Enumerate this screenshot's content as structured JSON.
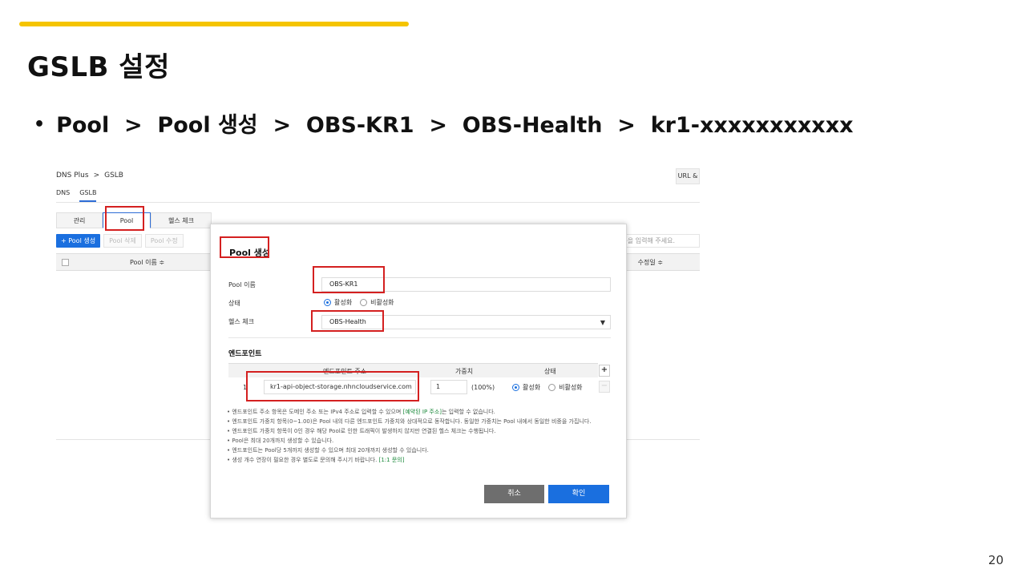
{
  "slide": {
    "title": "GSLB 설정",
    "breadcrumb": "Pool  >  Pool 생성  >  OBS-KR1  >  OBS-Health  >  kr1-xxxxxxxxxxx",
    "page_number": "20",
    "accent_color": "#f5c400"
  },
  "console": {
    "breadcrumb": {
      "root": "DNS Plus",
      "separator": ">",
      "current": "GSLB"
    },
    "url_button": "URL &",
    "top_tabs": [
      "DNS",
      "GSLB"
    ],
    "sub_tabs": [
      "관리",
      "Pool",
      "헬스 체크"
    ],
    "toolbar": {
      "create": "+ Pool 생성",
      "delete": "Pool 삭제",
      "edit": "Pool 수정"
    },
    "search_placeholder": "름을 입력해 주세요.",
    "table_headers": {
      "name": "Pool 이름 ≑",
      "modified": "수정일 ≑"
    }
  },
  "modal": {
    "title": "Pool 생성",
    "fields": {
      "pool_name_label": "Pool 이름",
      "pool_name_value": "OBS-KR1",
      "status_label": "상태",
      "status_enabled": "활성화",
      "status_disabled": "비활성화",
      "health_check_label": "헬스 체크",
      "health_check_value": "OBS-Health"
    },
    "endpoints": {
      "section_title": "엔드포인트",
      "headers": {
        "address": "엔드포인트 주소",
        "weight": "가중치",
        "status": "상태"
      },
      "add_button": "+",
      "remove_button": "−",
      "rows": [
        {
          "index": "1",
          "address": "kr1-api-object-storage.nhncloudservice.com",
          "weight": "1",
          "percent": "(100%)",
          "enabled": "활성화",
          "disabled": "비활성화"
        }
      ]
    },
    "notes": {
      "n1_pre": "엔드포인트 주소 항목은 도메인 주소 또는 IPv4 주소로 입력할 수 있으며 ",
      "n1_link": "[예약된 IP 주소]",
      "n1_post": "는 입력할 수 없습니다.",
      "n2": "엔드포인트 가중치 항목(0~1.00)은 Pool 내의 다른 엔드포인트 가중치와 상대적으로 동작합니다. 동일한 가중치는 Pool 내에서 동일한 비중을 가집니다.",
      "n3": "엔드포인트 가중치 항목이 0인 경우 해당 Pool로 인한 트래픽이 발생하지 않지만 연결된 헬스 체크는 수행됩니다.",
      "n4": "Pool은 최대 20개까지 생성할 수 있습니다.",
      "n5": "엔드포인트는 Pool당 5개까지 생성할 수 있으며 최대 20개까지 생성할 수 있습니다.",
      "n6_pre": "생성 개수 연장이 필요한 경우 별도로 문의해 주시기 바랍니다. ",
      "n6_link": "[1:1 문의]"
    },
    "buttons": {
      "cancel": "취소",
      "confirm": "확인"
    }
  },
  "colors": {
    "primary_blue": "#1a6fdf",
    "highlight_red": "#d42020",
    "note_link_green": "#1c8a3c"
  }
}
